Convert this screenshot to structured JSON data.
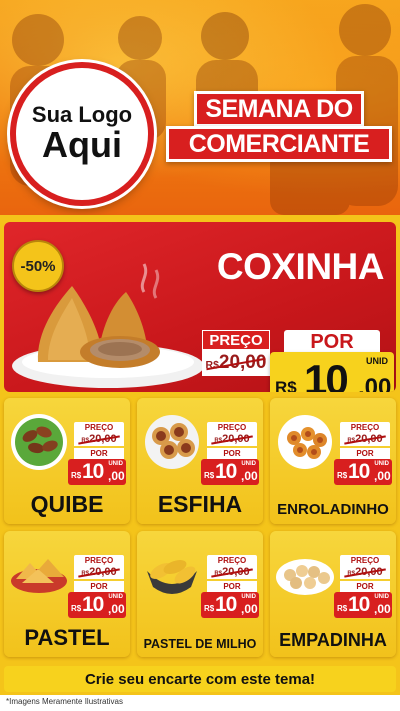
{
  "header": {
    "logo_line1": "Sua Logo",
    "logo_line2": "Aqui",
    "banner_line1": "SEMANA DO",
    "banner_line2": "COMERCIANTE"
  },
  "featured": {
    "discount": "-50%",
    "title": "COXINHA",
    "old_label": "PREÇO",
    "old_currency": "R$",
    "old_value": "20,00",
    "por_label": "POR",
    "new_currency": "R$",
    "new_int": "10",
    "new_cents": ",00",
    "unit": "UNID"
  },
  "products": [
    {
      "name": "QUIBE",
      "old_label": "PREÇO",
      "old_currency": "R$",
      "old_value": "20,00",
      "por_label": "POR",
      "new_currency": "R$",
      "new_int": "10",
      "new_cents": ",00",
      "unit": "UNID"
    },
    {
      "name": "ESFIHA",
      "old_label": "PREÇO",
      "old_currency": "R$",
      "old_value": "20,00",
      "por_label": "POR",
      "new_currency": "R$",
      "new_int": "10",
      "new_cents": ",00",
      "unit": "UNID"
    },
    {
      "name": "ENROLADINHO",
      "old_label": "PREÇO",
      "old_currency": "R$",
      "old_value": "20,00",
      "por_label": "POR",
      "new_currency": "R$",
      "new_int": "10",
      "new_cents": ",00",
      "unit": "UNID"
    },
    {
      "name": "PASTEL",
      "old_label": "PREÇO",
      "old_currency": "R$",
      "old_value": "20,00",
      "por_label": "POR",
      "new_currency": "R$",
      "new_int": "10",
      "new_cents": ",00",
      "unit": "UNID"
    },
    {
      "name": "PASTEL DE MILHO",
      "old_label": "PREÇO",
      "old_currency": "R$",
      "old_value": "20,00",
      "por_label": "POR",
      "new_currency": "R$",
      "new_int": "10",
      "new_cents": ",00",
      "unit": "UNID"
    },
    {
      "name": "EMPADINHA",
      "old_label": "PREÇO",
      "old_currency": "R$",
      "old_value": "20,00",
      "por_label": "POR",
      "new_currency": "R$",
      "new_int": "10",
      "new_cents": ",00",
      "unit": "UNID"
    }
  ],
  "footer": {
    "cta": "Crie seu encarte com este tema!",
    "disclaimer": "*Imagens Meramente Ilustrativas"
  },
  "colors": {
    "brand_red": "#d81f1f",
    "brand_yellow": "#f7d21d",
    "header_orange": "#f07d10"
  }
}
